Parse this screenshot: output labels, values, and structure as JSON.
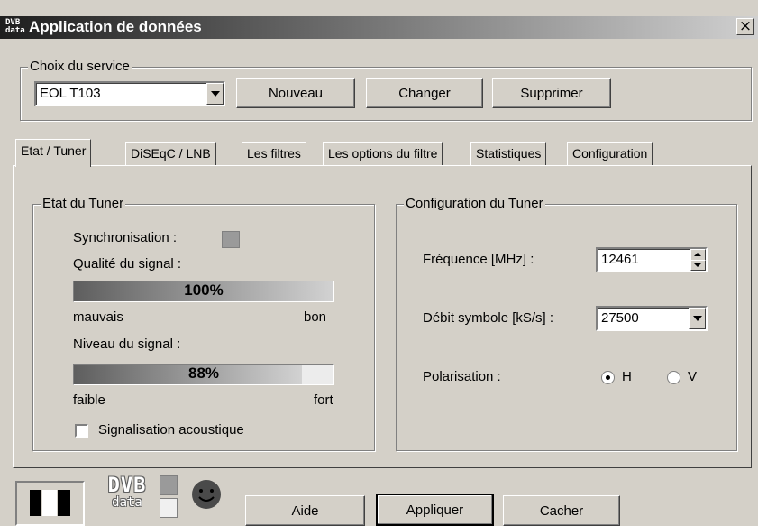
{
  "window": {
    "title": "Application de données",
    "icon": "DVB data",
    "close": "×"
  },
  "service": {
    "group_label": "Choix du service",
    "selected": "EOL T103",
    "buttons": {
      "new": "Nouveau",
      "change": "Changer",
      "delete": "Supprimer"
    }
  },
  "tabs": [
    {
      "label": "Etat / Tuner",
      "active": true
    },
    {
      "label": "DiSEqC / LNB"
    },
    {
      "label": "Les filtres"
    },
    {
      "label": "Les options du filtre"
    },
    {
      "label": "Statistiques"
    },
    {
      "label": "Configuration"
    }
  ],
  "tuner_state": {
    "group_label": "Etat du Tuner",
    "sync_label": "Synchronisation :",
    "quality_label": "Qualité du signal :",
    "quality_value": 100,
    "quality_pct": "100%",
    "quality_low": "mauvais",
    "quality_high": "bon",
    "level_label": "Niveau du signal :",
    "level_value": 88,
    "level_pct": "88%",
    "level_low": "faible",
    "level_high": "fort",
    "acoustic_label": "Signalisation acoustique",
    "acoustic_checked": false
  },
  "tuner_config": {
    "group_label": "Configuration du Tuner",
    "frequency_label": "Fréquence [MHz] :",
    "frequency_value": "12461",
    "symbol_rate_label": "Débit symbole [kS/s] :",
    "symbol_rate_value": "27500",
    "polarization_label": "Polarisation :",
    "pol_h": "H",
    "pol_v": "V",
    "pol_selected": "H"
  },
  "footer": {
    "logo": "DVB data",
    "help": "Aide",
    "apply": "Appliquer",
    "hide": "Cacher"
  }
}
